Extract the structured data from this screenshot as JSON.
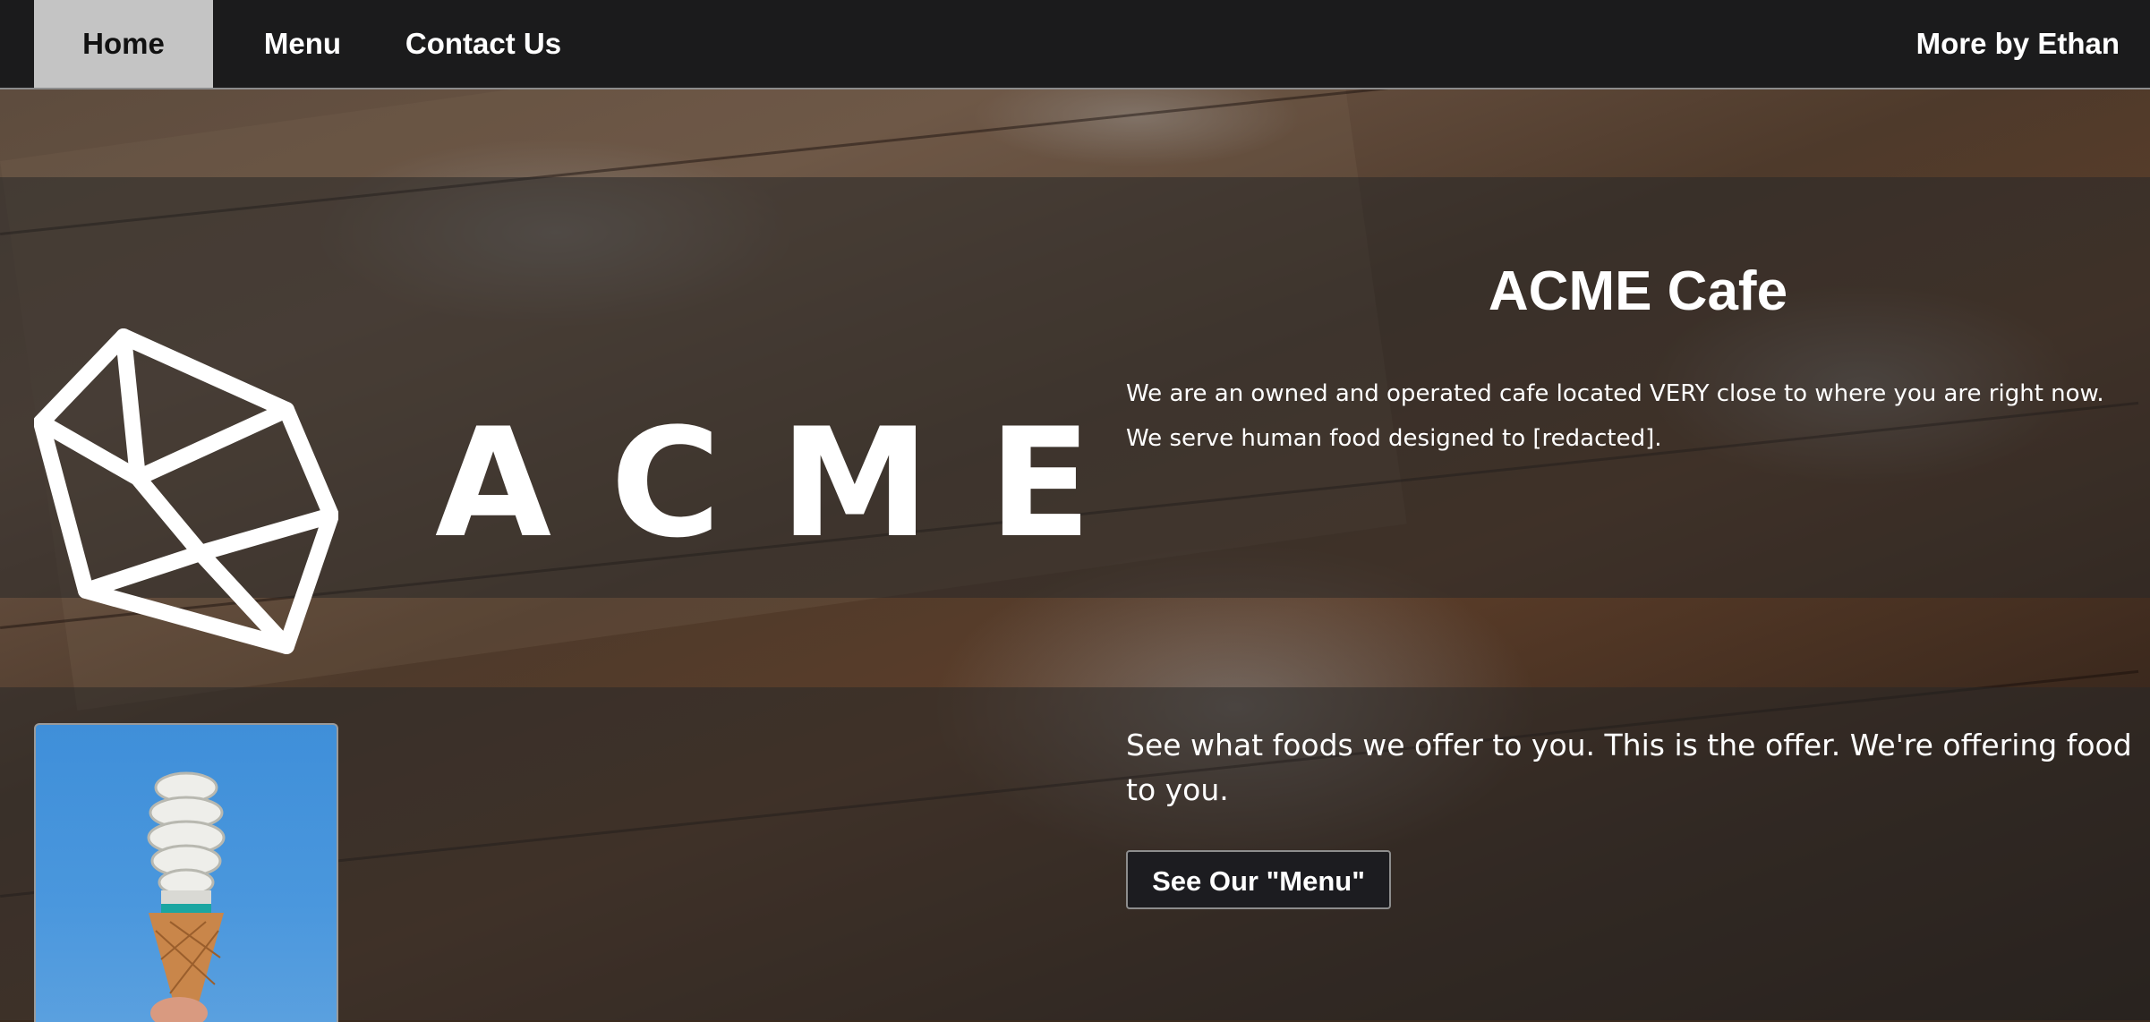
{
  "nav": {
    "home": "Home",
    "menu": "Menu",
    "contact": "Contact Us",
    "more": "More by Ethan"
  },
  "hero": {
    "logo_text": "ACME",
    "title": "ACME Cafe",
    "description": "We are an owned and operated cafe located VERY close to where you are right now. We serve human food designed to [redacted]."
  },
  "offer": {
    "text": "See what foods we offer to you. This is the offer. We're offering food to you.",
    "button_label": "See Our \"Menu\""
  },
  "colors": {
    "nav_bg": "#1b1b1c",
    "nav_active": "#c4c4c4",
    "button_bg": "#1c1c20"
  }
}
